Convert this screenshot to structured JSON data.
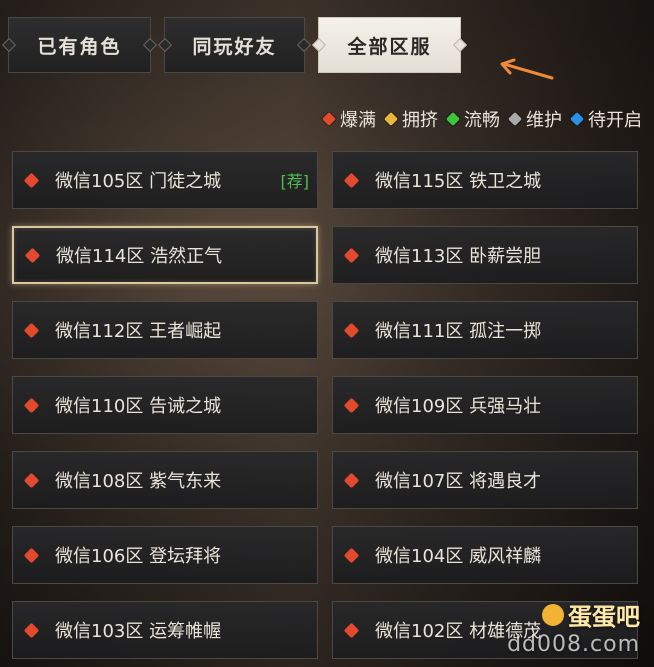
{
  "tabs": [
    {
      "label": "已有角色",
      "active": false
    },
    {
      "label": "同玩好友",
      "active": false
    },
    {
      "label": "全部区服",
      "active": true
    }
  ],
  "legend": [
    {
      "label": "爆满",
      "color": "#e24a2e"
    },
    {
      "label": "拥挤",
      "color": "#e8b73a"
    },
    {
      "label": "流畅",
      "color": "#3cc63c"
    },
    {
      "label": "维护",
      "color": "#a9a9a9"
    },
    {
      "label": "待开启",
      "color": "#2b8fe8"
    }
  ],
  "servers": [
    {
      "label": "微信105区 门徒之城",
      "status_color": "#e24a2e",
      "badge": "[荐]",
      "selected": false
    },
    {
      "label": "微信115区 铁卫之城",
      "status_color": "#e24a2e",
      "badge": "",
      "selected": false
    },
    {
      "label": "微信114区 浩然正气",
      "status_color": "#e24a2e",
      "badge": "",
      "selected": true
    },
    {
      "label": "微信113区 卧薪尝胆",
      "status_color": "#e24a2e",
      "badge": "",
      "selected": false
    },
    {
      "label": "微信112区 王者崛起",
      "status_color": "#e24a2e",
      "badge": "",
      "selected": false
    },
    {
      "label": "微信111区 孤注一掷",
      "status_color": "#e24a2e",
      "badge": "",
      "selected": false
    },
    {
      "label": "微信110区 告诫之城",
      "status_color": "#e24a2e",
      "badge": "",
      "selected": false
    },
    {
      "label": "微信109区 兵强马壮",
      "status_color": "#e24a2e",
      "badge": "",
      "selected": false
    },
    {
      "label": "微信108区 紫气东来",
      "status_color": "#e24a2e",
      "badge": "",
      "selected": false
    },
    {
      "label": "微信107区 将遇良才",
      "status_color": "#e24a2e",
      "badge": "",
      "selected": false
    },
    {
      "label": "微信106区 登坛拜将",
      "status_color": "#e24a2e",
      "badge": "",
      "selected": false
    },
    {
      "label": "微信104区 威风祥麟",
      "status_color": "#e24a2e",
      "badge": "",
      "selected": false
    },
    {
      "label": "微信103区 运筹帷幄",
      "status_color": "#e24a2e",
      "badge": "",
      "selected": false
    },
    {
      "label": "微信102区 材雄德茂",
      "status_color": "#e24a2e",
      "badge": "",
      "selected": false
    }
  ],
  "annotation_color": "#f08a3a",
  "watermark": {
    "top": "蛋蛋吧",
    "bottom": "dd008.com"
  }
}
